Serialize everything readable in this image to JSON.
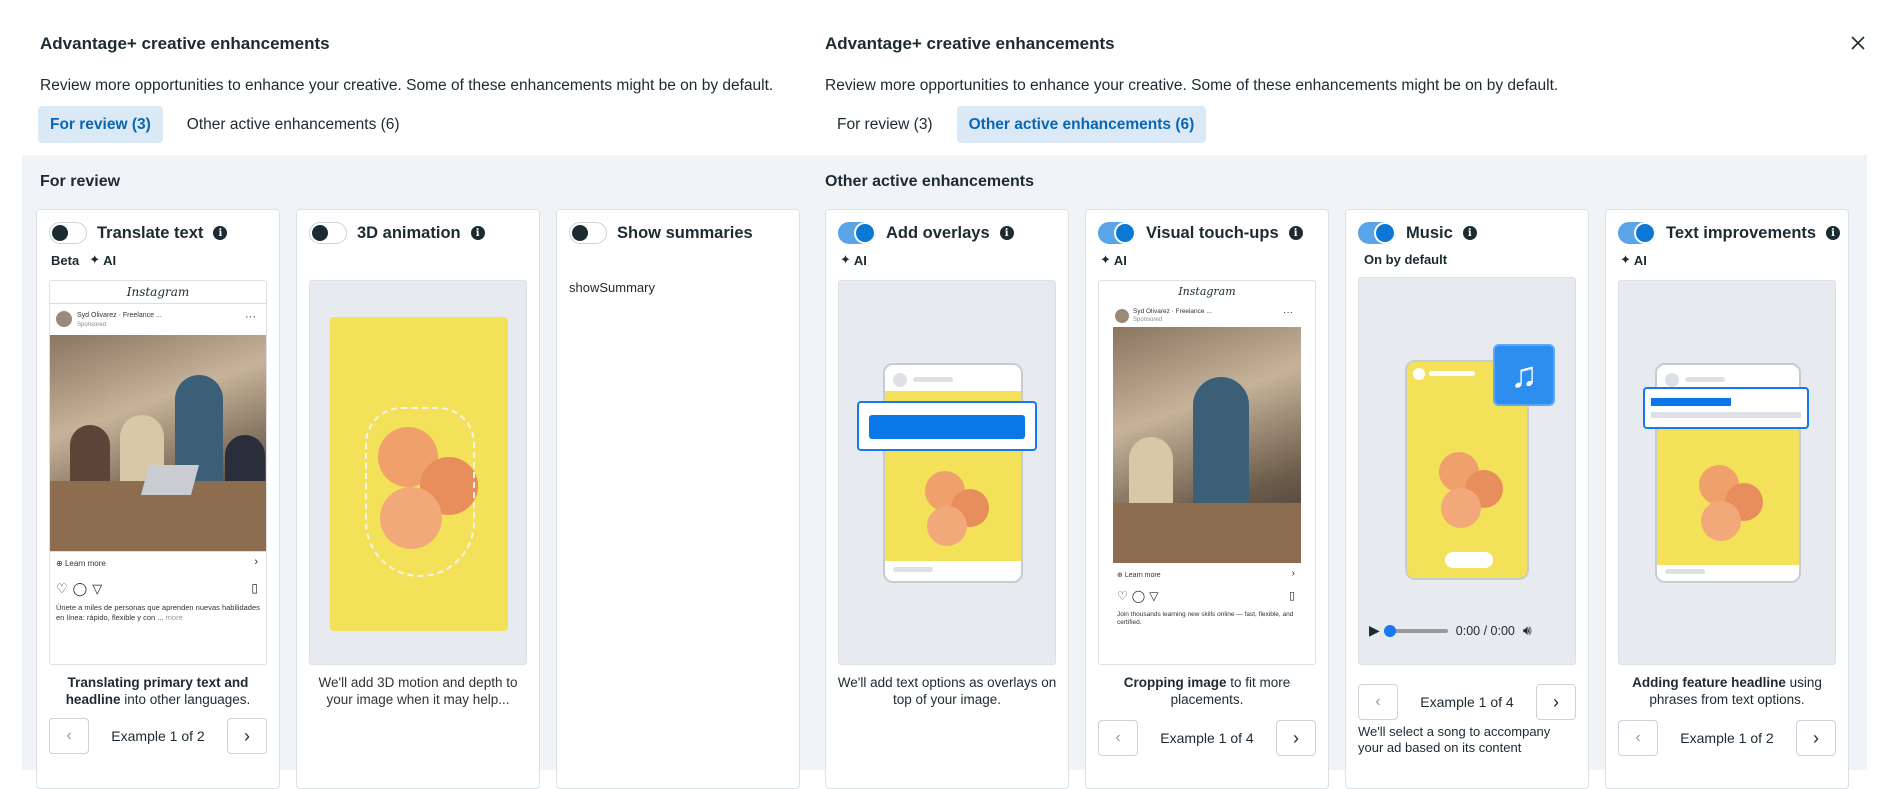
{
  "left": {
    "title": "Advantage+ creative enhancements",
    "subtitle": "Review more opportunities to enhance your creative. Some of these enhancements might be on by default.",
    "tab_review": "For review (3)",
    "tab_other": "Other active enhancements (6)",
    "section": "For review",
    "cards": [
      {
        "title": "Translate text",
        "badge1": "Beta",
        "badge2": "AI",
        "desc_bold": "Translating primary text and headline",
        "desc_rest": " into other languages.",
        "pager": "Example 1 of 2",
        "ig_logo": "Instagram",
        "ig_user": "Syd Olivarez · Freelance ...",
        "ig_sponsored": "Sponsored",
        "ig_learn": "Learn more",
        "ig_caption": "Únete a miles de personas que aprenden nuevas habilidades en línea: rápido, flexible y con ...",
        "ig_more": "more"
      },
      {
        "title": "3D animation",
        "desc": "We'll add 3D motion and depth to your image when it may help..."
      },
      {
        "title": "Show summaries",
        "body": "showSummary"
      }
    ]
  },
  "right": {
    "title": "Advantage+ creative enhancements",
    "subtitle": "Review more opportunities to enhance your creative. Some of these enhancements might be on by default.",
    "tab_review": "For review (3)",
    "tab_other": "Other active enhancements (6)",
    "section": "Other active enhancements",
    "cards": [
      {
        "title": "Add overlays",
        "badge": "AI",
        "desc": "We'll add text options as overlays on top of your image."
      },
      {
        "title": "Visual touch-ups",
        "badge": "AI",
        "desc_bold": "Cropping image",
        "desc_rest": " to fit more placements.",
        "pager": "Example 1 of 4",
        "ig_logo": "Instagram",
        "ig_user": "Syd Olivarez · Freelance ...",
        "ig_sponsored": "Sponsored",
        "ig_learn": "Learn more",
        "ig_caption": "Join thousands learning new skills online — fast, flexible, and certified."
      },
      {
        "title": "Music",
        "badge": "On by default",
        "time": "0:00 / 0:00",
        "pager": "Example 1 of 4",
        "desc": "We'll select a song to accompany your ad based on its content"
      },
      {
        "title": "Text improvements",
        "badge": "AI",
        "desc_bold": "Adding feature headline",
        "desc_rest": " using phrases from text options.",
        "pager": "Example 1 of 2"
      }
    ]
  }
}
